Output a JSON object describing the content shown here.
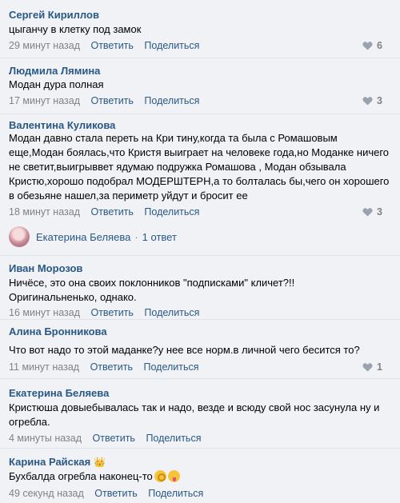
{
  "likes_icon": "heart-icon",
  "comments": [
    {
      "author": "Сергей Кириллов",
      "text": "цыганчу в клетку под замок",
      "time": "29 минут назад",
      "reply": "Ответить",
      "share": "Поделиться",
      "likes": "6"
    },
    {
      "author": "Людмила Лямина",
      "text": "Модан дура полная",
      "time": "17 минут назад",
      "reply": "Ответить",
      "share": "Поделиться",
      "likes": "3"
    },
    {
      "author": "Валентина Куликова",
      "text": "Модан давно стала переть на Кри тину,когда та была с Ромашовым еще,Модан боялась,что Кристя выиграет на человеке года,но Моданке ничего не светит,выигрыввет ядумаю подружка Ромашова , Модан обзывала Кристю,хорошо подобрал МОДЕРШТЕРН,а то болталась бы,чего он хорошего в обезьяне нашел,за периметр уйдут и бросит ее",
      "time": "18 минут назад",
      "reply": "Ответить",
      "share": "Поделиться",
      "likes": "3"
    },
    {
      "author": "Иван Морозов",
      "text": "Ничёсе, это она своих поклонников \"подписками\" кличет?!! Оригинальненько, однако.",
      "time": "16 минут назад",
      "reply": "Ответить",
      "share": "Поделиться",
      "likes": ""
    },
    {
      "author": "Алина Бронникова",
      "text": "Что вот надо то этой маданке?у нее все норм.в личной чего бесится то?",
      "time": "11 минут назад",
      "reply": "Ответить",
      "share": "Поделиться",
      "likes": "1"
    },
    {
      "author": "Екатерина Беляева",
      "text": "Кристюша довыебывалась так и надо, везде и всюду свой нос засунула ну и огребла.",
      "time": "4 минуты назад",
      "reply": "Ответить",
      "share": "Поделиться",
      "likes": ""
    },
    {
      "author": "Карина Райская",
      "text": "Бухбалда огребла наконец-то",
      "time": "49 секунд назад",
      "reply": "Ответить",
      "share": "Поделиться",
      "likes": ""
    }
  ],
  "thread": {
    "name": "Екатерина Беляева",
    "count": "1 ответ"
  }
}
